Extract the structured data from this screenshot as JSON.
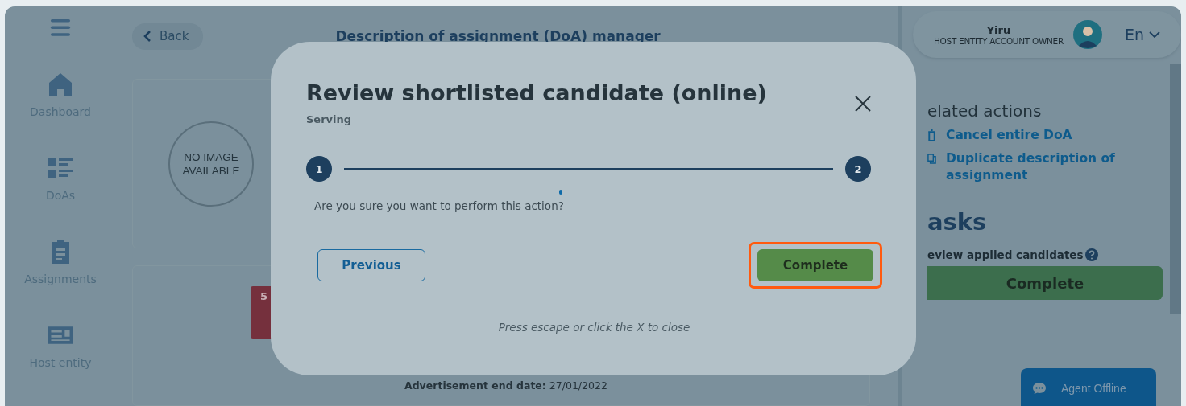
{
  "sidebar": {
    "items": [
      {
        "label": "Dashboard",
        "kind": "home"
      },
      {
        "label": "DoAs",
        "kind": "list"
      },
      {
        "label": "Assignments",
        "kind": "clipboard"
      },
      {
        "label": "Host entity",
        "kind": "card"
      }
    ]
  },
  "back_button": {
    "label": "Back"
  },
  "page_title": "Description of assignment (DoA) manager",
  "image_placeholder": "NO IMAGE AVAILABLE",
  "badge": "5",
  "advertisement_end": {
    "label": "Advertisement end date:",
    "value": "27/01/2022"
  },
  "user": {
    "name": "Yiru",
    "role": "HOST ENTITY ACCOUNT OWNER"
  },
  "language": "En",
  "related_actions": {
    "title": "elated actions",
    "items": [
      {
        "label": "Cancel entire DoA",
        "kind": "trash"
      },
      {
        "label": "Duplicate description of assignment",
        "kind": "copy"
      }
    ]
  },
  "tasks": {
    "title": "asks",
    "task_link": "eview applied candidates",
    "button": "Complete"
  },
  "chat": {
    "label": "Agent Offline"
  },
  "modal": {
    "title": "Review shortlisted candidate (online)",
    "subtitle": "Serving",
    "steps": [
      "1",
      "2"
    ],
    "message": "Are you sure you want to perform this action?",
    "previous": "Previous",
    "complete": {
      "label": "Complete",
      "highlighted": true
    },
    "hint": "Press escape or click the X to close"
  }
}
